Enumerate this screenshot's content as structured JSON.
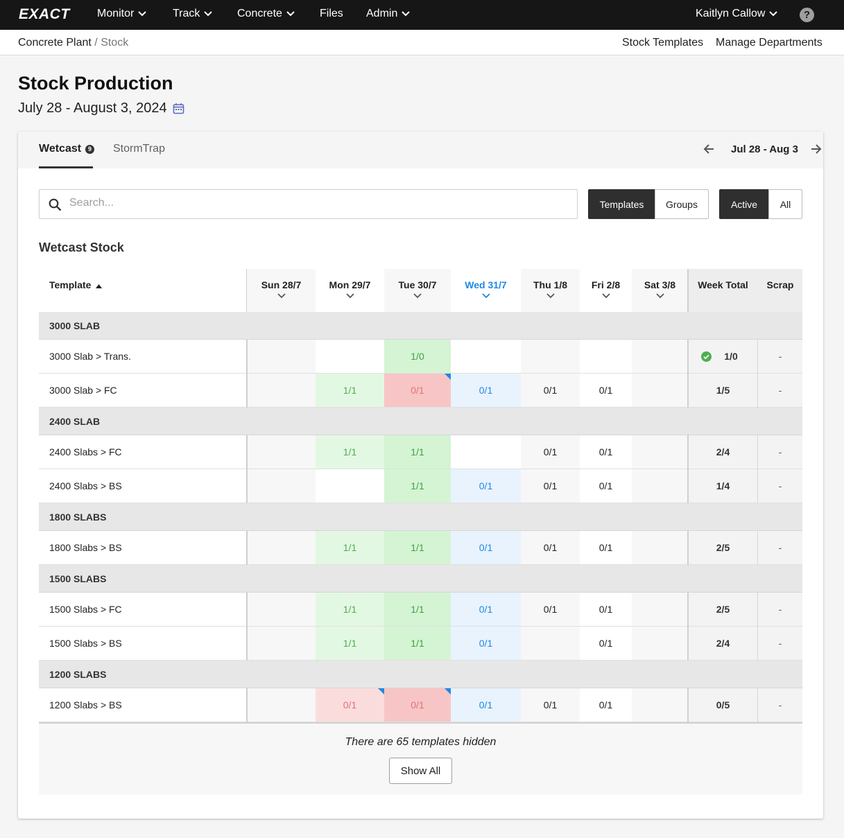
{
  "nav": {
    "brand": "EXACT",
    "items": [
      {
        "label": "Monitor",
        "dropdown": true
      },
      {
        "label": "Track",
        "dropdown": true
      },
      {
        "label": "Concrete",
        "dropdown": true
      },
      {
        "label": "Files",
        "dropdown": false
      },
      {
        "label": "Admin",
        "dropdown": true
      }
    ],
    "user": "Kaitlyn Callow",
    "help": "?"
  },
  "breadcrumb": {
    "root": "Concrete Plant",
    "separator": " / ",
    "current": "Stock"
  },
  "sublinks": {
    "templates": "Stock Templates",
    "departments": "Manage Departments"
  },
  "page": {
    "title": "Stock Production",
    "daterange": "July 28 - August 3, 2024"
  },
  "tabs": {
    "wetcast": "Wetcast",
    "wetcast_badge": "9",
    "stormtrap": "StormTrap"
  },
  "week_nav": {
    "label": "Jul 28 - Aug 3"
  },
  "search": {
    "placeholder": "Search...",
    "value": ""
  },
  "toggles": {
    "templates": "Templates",
    "groups": "Groups",
    "active": "Active",
    "all": "All",
    "view_selected": "Templates",
    "filter_selected": "Active"
  },
  "section_title": "Wetcast Stock",
  "table": {
    "headers": {
      "template": "Template",
      "days": [
        "Sun 28/7",
        "Mon 29/7",
        "Tue 30/7",
        "Wed 31/7",
        "Thu 1/8",
        "Fri 2/8",
        "Sat 3/8"
      ],
      "today_index": 3,
      "week_total": "Week Total",
      "scrap": "Scrap"
    },
    "groups": [
      {
        "name": "3000 SLAB",
        "rows": [
          {
            "name": "3000 Slab > Trans.",
            "cells": [
              "",
              "",
              "1/0",
              "",
              "",
              "",
              ""
            ],
            "week_total": "1/0",
            "complete": true,
            "scrap": "-"
          },
          {
            "name": "3000 Slab > FC",
            "cells": [
              "",
              "1/1",
              "0/1",
              "0/1",
              "0/1",
              "0/1",
              ""
            ],
            "week_total": "1/5",
            "complete": false,
            "scrap": "-"
          }
        ]
      },
      {
        "name": "2400 SLAB",
        "rows": [
          {
            "name": "2400 Slabs > FC",
            "cells": [
              "",
              "1/1",
              "1/1",
              "",
              "0/1",
              "0/1",
              ""
            ],
            "week_total": "2/4",
            "complete": false,
            "scrap": "-"
          },
          {
            "name": "2400 Slabs > BS",
            "cells": [
              "",
              "",
              "1/1",
              "0/1",
              "0/1",
              "0/1",
              ""
            ],
            "week_total": "1/4",
            "complete": false,
            "scrap": "-"
          }
        ]
      },
      {
        "name": "1800 SLABS",
        "rows": [
          {
            "name": "1800 Slabs > BS",
            "cells": [
              "",
              "1/1",
              "1/1",
              "0/1",
              "0/1",
              "0/1",
              ""
            ],
            "week_total": "2/5",
            "complete": false,
            "scrap": "-"
          }
        ]
      },
      {
        "name": "1500 SLABS",
        "rows": [
          {
            "name": "1500 Slabs > FC",
            "cells": [
              "",
              "1/1",
              "1/1",
              "0/1",
              "0/1",
              "0/1",
              ""
            ],
            "week_total": "2/5",
            "complete": false,
            "scrap": "-"
          },
          {
            "name": "1500 Slabs > BS",
            "cells": [
              "",
              "1/1",
              "1/1",
              "0/1",
              "",
              "0/1",
              ""
            ],
            "week_total": "2/4",
            "complete": false,
            "scrap": "-"
          }
        ]
      },
      {
        "name": "1200 SLABS",
        "rows": [
          {
            "name": "1200 Slabs > BS",
            "cells": [
              "",
              "0/1",
              "0/1",
              "0/1",
              "0/1",
              "0/1",
              ""
            ],
            "week_total": "0/5",
            "complete": false,
            "scrap": "-"
          }
        ]
      }
    ],
    "hidden_text": "There are 65 templates hidden",
    "show_all": "Show All"
  },
  "colors": {
    "nav_bg": "#161616",
    "done": "#4caf50",
    "missed": "#e07373",
    "today": "#1e88e5"
  }
}
